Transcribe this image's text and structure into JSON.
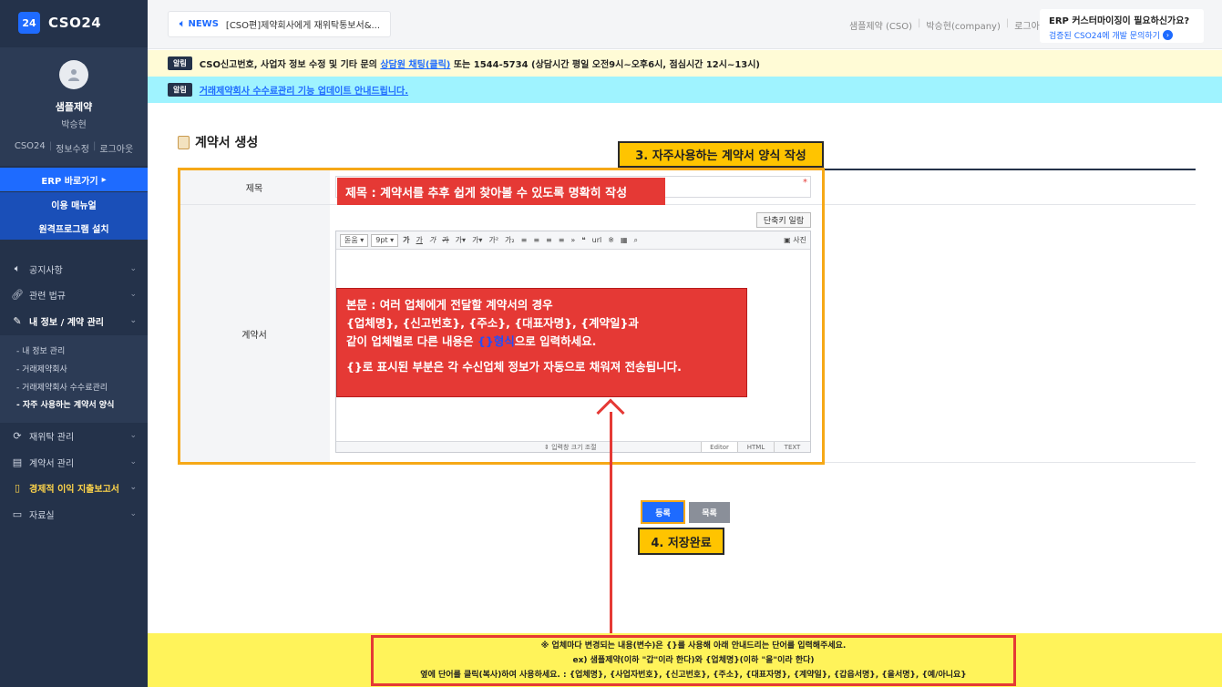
{
  "app": {
    "logo_badge": "24",
    "logo_text": "CSO24"
  },
  "profile": {
    "org": "샘플제약",
    "user": "박승현",
    "links": [
      "CSO24",
      "정보수정",
      "로그아웃"
    ]
  },
  "sidebar": {
    "erp_button": "ERP 바로가기",
    "manual_button": "이용 매뉴얼",
    "remote_button": "원격프로그램 설치",
    "items": [
      {
        "label": "공지사항",
        "icon": "speaker-icon"
      },
      {
        "label": "관련 법규",
        "icon": "link-icon"
      },
      {
        "label": "내 정보 / 계약 관리",
        "icon": "pencil-icon"
      },
      {
        "label": "재위탁 관리",
        "icon": "refresh-icon"
      },
      {
        "label": "계약서 관리",
        "icon": "document-icon"
      },
      {
        "label": "경제적 이익 지출보고서",
        "icon": "file-icon"
      },
      {
        "label": "자료실",
        "icon": "archive-icon"
      }
    ],
    "sub_items": [
      "- 내 정보 관리",
      "- 거래제약회사",
      "- 거래제약회사 수수료관리",
      "- 자주 사용하는 계약서 양식"
    ]
  },
  "header": {
    "news_label": "NEWS",
    "news_text": "[CSO편]제약회사에게 재위탁통보서&...",
    "top_links": [
      "샘플제약 (CSO)",
      "박승현(company)",
      "로그아웃"
    ],
    "erp_question": "ERP 커스터마이징이 필요하신가요?",
    "erp_link": "검증된 CSO24에 개발 문의하기"
  },
  "notices": {
    "tag": "알림",
    "n1_before": "CSO신고번호, 사업자 정보 수정 및 기타 문의",
    "n1_link": "상담원 채팅(클릭)",
    "n1_after": "또는 1544-5734 (상담시간 평일 오전9시~오후6시, 점심시간 12시~13시)",
    "n2_link": "거래제약회사 수수료관리 기능 업데이트 안내드립니다."
  },
  "main": {
    "page_title": "계약서 생성",
    "label_title": "제목",
    "label_contract": "계약서",
    "required_mark": "*",
    "shortcut_button": "단축키 일람",
    "toolbar": {
      "font": "돋움",
      "size": "9pt",
      "photo": "사진"
    },
    "editor_resize": "입력창 크기 조절",
    "mode_tabs": [
      "Editor",
      "HTML",
      "TEXT"
    ],
    "save_button": "등록",
    "list_button": "목록"
  },
  "annotations": {
    "step3": "3. 자주사용하는 계약서 양식 작성",
    "title_note": "제목 : 계약서를 추후 쉽게 찾아볼 수 있도록 명확히 작성",
    "body_line1": "본문 : 여러 업체에게 전달할 계약서의 경우",
    "body_line2": "{업체명}, {신고번호}, {주소}, {대표자명}, {계약일}과",
    "body_line3a": "같이 업체별로 다른 내용은",
    "body_line3hl": "{}형식",
    "body_line3b": "으로 입력하세요.",
    "body_line4": "{}로 표시된 부분은 각 수신업체 정보가 자동으로 채워져 전송됩니다.",
    "step4": "4. 저장완료"
  },
  "bottom": {
    "line1": "※ 업체마다 변경되는 내용(변수)은 {}를 사용해 아래 안내드리는 단어를 입력해주세요.",
    "line2": "ex) 샘플제약(이하 \"갑\"이라 한다)와 {업체명}(이하 \"을\"이라 한다)",
    "line3": "옆에 단어를 클릭(복사)하여 사용하세요. : {업체명}, {사업자번호}, {신고번호}, {주소}, {대표자명}, {계약일}, {갑읍서명}, {을서명}, {예/아니요}"
  }
}
